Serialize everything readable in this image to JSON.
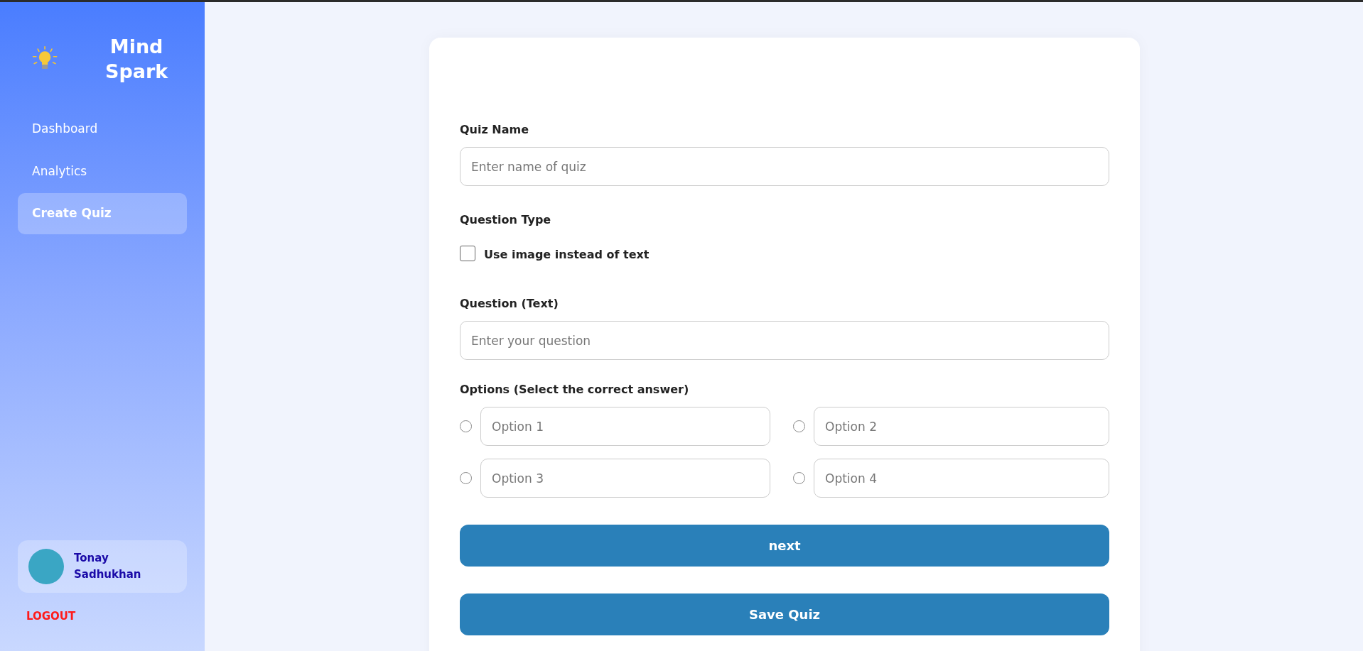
{
  "sidebar": {
    "brand": "Mind Spark",
    "nav": [
      {
        "label": "Dashboard",
        "selected": false
      },
      {
        "label": "Analytics",
        "selected": false
      },
      {
        "label": "Create Quiz",
        "selected": true
      }
    ],
    "user": {
      "name": "Tonay Sadhukhan"
    },
    "logout": "LOGOUT"
  },
  "form": {
    "quiz_name": {
      "label": "Quiz Name",
      "placeholder": "Enter name of quiz"
    },
    "question_type": {
      "label": "Question Type"
    },
    "image_toggle": {
      "label": "Use image instead of text",
      "checked": false
    },
    "question": {
      "label": "Question (Text)",
      "placeholder": "Enter your question"
    },
    "options": {
      "label": "Options (Select the correct answer)",
      "items": [
        {
          "placeholder": "Option 1",
          "selected": false
        },
        {
          "placeholder": "Option 2",
          "selected": false
        },
        {
          "placeholder": "Option 3",
          "selected": false
        },
        {
          "placeholder": "Option 4",
          "selected": false
        }
      ]
    },
    "buttons": [
      "next",
      "Save Quiz"
    ]
  }
}
